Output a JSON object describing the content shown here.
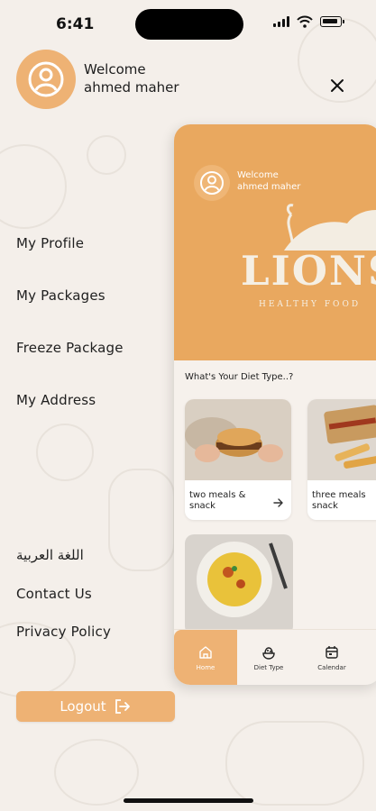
{
  "status_bar": {
    "time": "6:41"
  },
  "drawer": {
    "welcome": "Welcome",
    "user_name": "ahmed maher",
    "menu_top": [
      "My Profile",
      "My Packages",
      "Freeze Package",
      "My Address"
    ],
    "menu_bottom": [
      "اللغة العربية",
      "Contact Us",
      "Privacy Policy"
    ],
    "logout": "Logout"
  },
  "preview": {
    "welcome": "Welcome",
    "user_name": "ahmed maher",
    "brand": "LIONS",
    "brand_sub": "HEALTHY FOOD",
    "diet_title": "What's Your Diet Type..?",
    "cards": [
      {
        "label_line1": "two meals &",
        "label_line2": "snack"
      },
      {
        "label_line1": "three meals",
        "label_line2": "snack"
      }
    ],
    "tabs": [
      "Home",
      "Diet Type",
      "Calendar"
    ]
  },
  "colors": {
    "accent": "#eeb274",
    "hero": "#e9a85f",
    "background": "#f4efea"
  },
  "icons": [
    "user-icon",
    "close-icon",
    "logout-icon",
    "home-icon",
    "diet-icon",
    "calendar-icon",
    "arrow-right-icon"
  ]
}
